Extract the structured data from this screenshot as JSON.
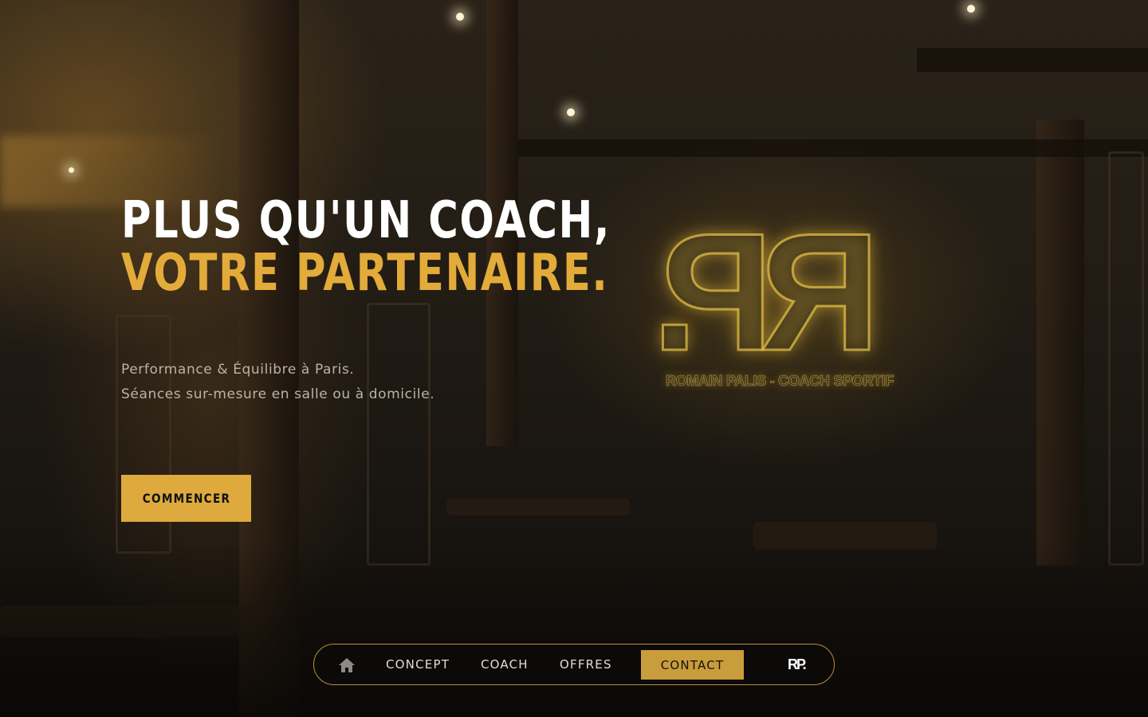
{
  "hero": {
    "headline_line1": "PLUS QU'UN COACH,",
    "headline_line2": "VOTRE PARTENAIRE.",
    "subtitle_line1": "Performance & Équilibre à Paris.",
    "subtitle_line2": "Séances sur-mesure en salle ou à domicile.",
    "cta_label": "COMMENCER"
  },
  "neon_sign": {
    "mark": "RP.",
    "caption": "ROMAIN PALIS - COACH SPORTIF"
  },
  "nav": {
    "home_icon": "home-icon",
    "items": [
      {
        "label": "CONCEPT"
      },
      {
        "label": "COACH"
      },
      {
        "label": "OFFRES"
      }
    ],
    "contact_label": "CONTACT",
    "logo": "RP."
  },
  "colors": {
    "accent": "#deaa3e",
    "headline_white": "#ffffff",
    "headline_gold": "#e3ab3a",
    "nav_border": "#b98f33"
  }
}
